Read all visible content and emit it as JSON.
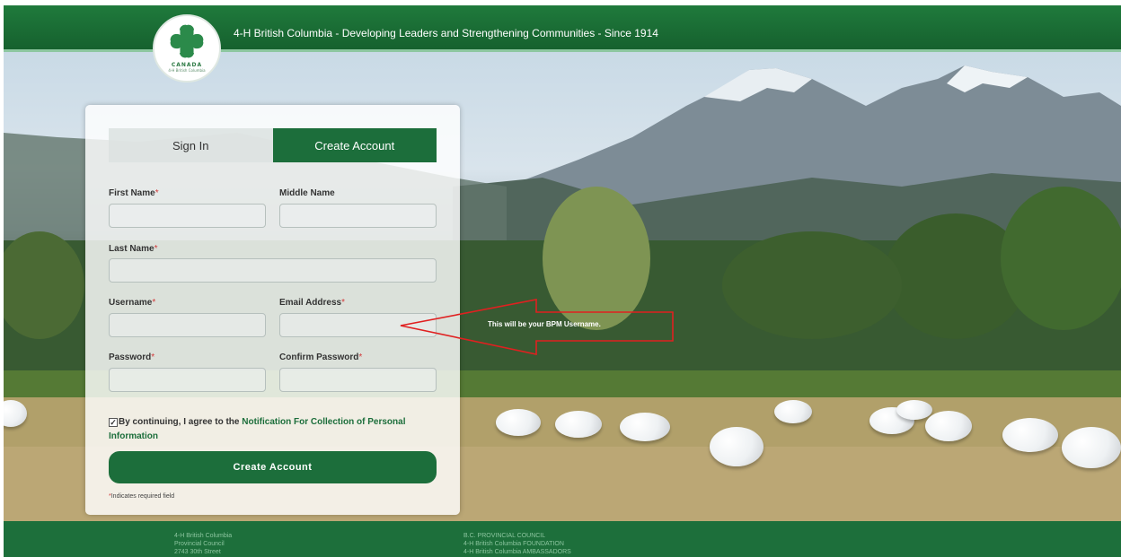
{
  "header": {
    "tagline": "4-H British Columbia - Developing Leaders and Strengthening Communities - Since 1914"
  },
  "logo": {
    "country": "CANADA",
    "org": "4-H British Columbia",
    "icon": "four-leaf-clover-icon"
  },
  "tabs": [
    {
      "label": "Sign In",
      "active": false
    },
    {
      "label": "Create Account",
      "active": true
    }
  ],
  "form": {
    "first_name": {
      "label": "First Name",
      "required": "*",
      "value": ""
    },
    "middle_name": {
      "label": "Middle Name",
      "value": ""
    },
    "last_name": {
      "label": "Last Name",
      "required": "*",
      "value": ""
    },
    "username": {
      "label": "Username",
      "required": "*",
      "value": ""
    },
    "email": {
      "label": "Email Address",
      "required": "*",
      "value": ""
    },
    "password": {
      "label": "Password",
      "required": "*",
      "value": ""
    },
    "confirm_password": {
      "label": "Confirm Password",
      "required": "*",
      "value": ""
    },
    "agree_prefix": "By continuing, I agree to the ",
    "agree_link": "Notification For Collection of Personal Information",
    "agree_checked": true,
    "submit_label": "Create Account",
    "required_marker": "*",
    "required_note": "Indicates required field"
  },
  "callout": {
    "text": "This will be your BPM Username."
  },
  "footer": {
    "left": [
      "4-H British Columbia",
      "Provincial Council",
      "2743 30th Street"
    ],
    "right": [
      "B.C. PROVINCIAL COUNCIL",
      "4-H British Columbia FOUNDATION",
      "4-H British Columbia AMBASSADORS"
    ]
  },
  "colors": {
    "brand_green": "#1c6e3b",
    "required_red": "#d23b3b",
    "callout_red": "#e02020"
  }
}
